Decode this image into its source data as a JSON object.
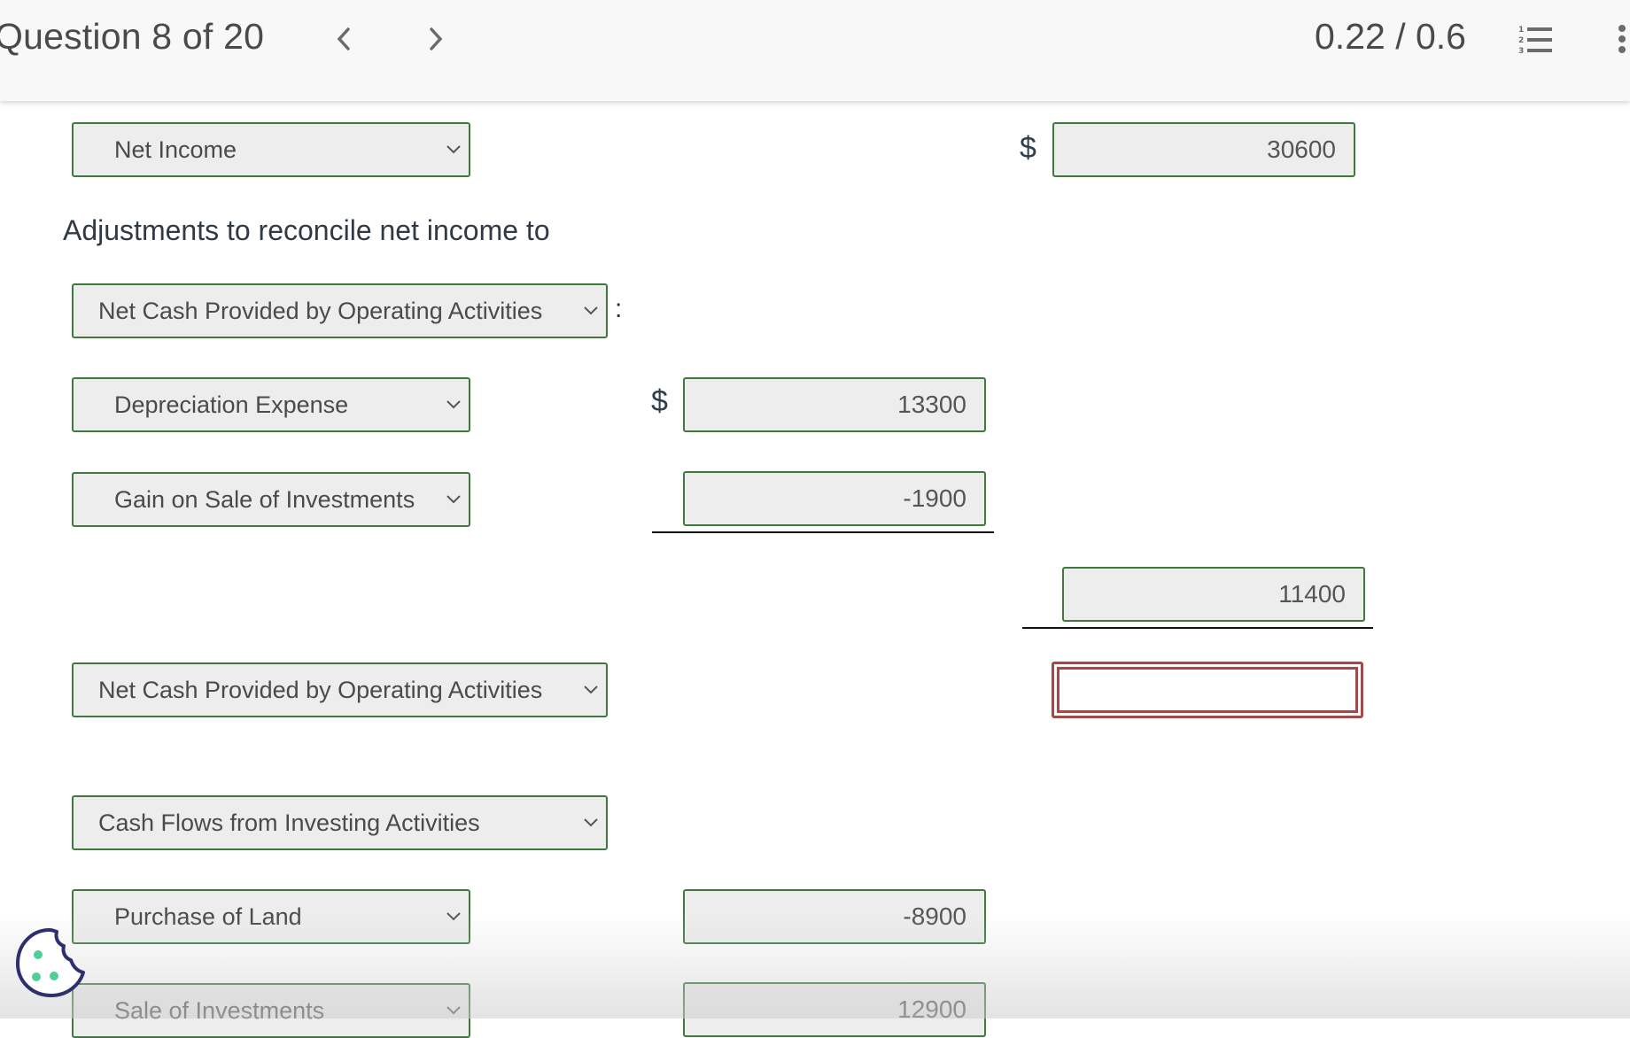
{
  "header": {
    "question_label": "Question 8 of 20",
    "score": "0.22 / 0.6",
    "prev_icon": "chevron-left-icon",
    "next_icon": "chevron-right-icon",
    "list_icon": "numbered-list-icon",
    "more_icon": "more-vertical-icon"
  },
  "statement": {
    "heading": "Adjustments to reconcile net income to",
    "colon": ":",
    "currency": "$",
    "rows": [
      {
        "select": "Net Income",
        "amount_right": "30600"
      },
      {
        "select": "Net Cash Provided by Operating Activities"
      },
      {
        "select": "Depreciation Expense",
        "amount_mid": "13300"
      },
      {
        "select": "Gain on Sale of Investments",
        "amount_mid": "-1900"
      },
      {
        "subtotal_right": "11400"
      },
      {
        "select": "Net Cash Provided by Operating Activities",
        "amount_right": ""
      },
      {
        "select": "Cash Flows from Investing Activities"
      },
      {
        "select": "Purchase of Land",
        "amount_mid": "-8900"
      },
      {
        "select": "Sale of Investments",
        "amount_mid": "12900"
      }
    ]
  },
  "colors": {
    "valid_border": "#3e7a3e",
    "error_border": "#a84747",
    "field_bg": "#ededed",
    "cookie_outline": "#2e2f6e",
    "cookie_dots": "#4fcf97"
  },
  "cookie_icon": "cookie-icon"
}
